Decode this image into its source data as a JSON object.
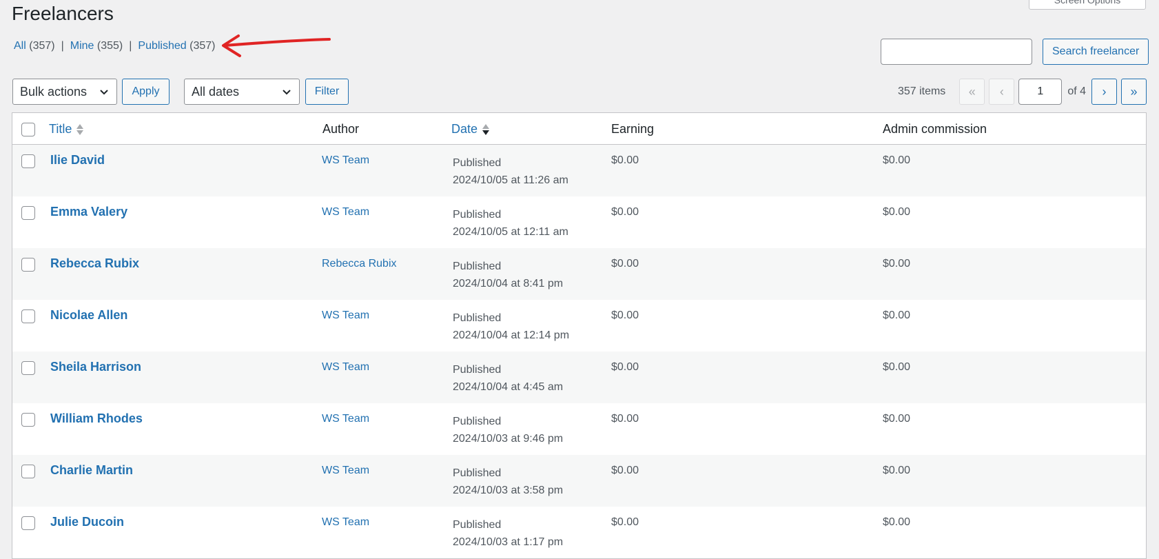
{
  "screen_options": {
    "label": "Screen Options"
  },
  "page": {
    "title": "Freelancers"
  },
  "views": [
    {
      "label": "All",
      "count": "(357)"
    },
    {
      "label": "Mine",
      "count": "(355)"
    },
    {
      "label": "Published",
      "count": "(357)"
    }
  ],
  "separator": "|",
  "search": {
    "value": "",
    "button_label": "Search freelancer"
  },
  "toolbar": {
    "bulk_actions": "Bulk actions",
    "apply_label": "Apply",
    "dates": "All dates",
    "filter_label": "Filter"
  },
  "pagination": {
    "items": "357 items",
    "first": "«",
    "prev": "‹",
    "current": "1",
    "of_label": "of 4",
    "next": "›",
    "last": "»"
  },
  "columns": {
    "title": "Title",
    "author": "Author",
    "date": "Date",
    "earning": "Earning",
    "commission": "Admin commission"
  },
  "rows": [
    {
      "title": "Ilie David",
      "author": "WS Team",
      "status": "Published",
      "date": "2024/10/05 at 11:26 am",
      "earning": "$0.00",
      "commission": "$0.00"
    },
    {
      "title": "Emma Valery",
      "author": "WS Team",
      "status": "Published",
      "date": "2024/10/05 at 12:11 am",
      "earning": "$0.00",
      "commission": "$0.00"
    },
    {
      "title": "Rebecca Rubix",
      "author": "Rebecca Rubix",
      "status": "Published",
      "date": "2024/10/04 at 8:41 pm",
      "earning": "$0.00",
      "commission": "$0.00"
    },
    {
      "title": "Nicolae Allen",
      "author": "WS Team",
      "status": "Published",
      "date": "2024/10/04 at 12:14 pm",
      "earning": "$0.00",
      "commission": "$0.00"
    },
    {
      "title": "Sheila Harrison",
      "author": "WS Team",
      "status": "Published",
      "date": "2024/10/04 at 4:45 am",
      "earning": "$0.00",
      "commission": "$0.00"
    },
    {
      "title": "William Rhodes",
      "author": "WS Team",
      "status": "Published",
      "date": "2024/10/03 at 9:46 pm",
      "earning": "$0.00",
      "commission": "$0.00"
    },
    {
      "title": "Charlie Martin",
      "author": "WS Team",
      "status": "Published",
      "date": "2024/10/03 at 3:58 pm",
      "earning": "$0.00",
      "commission": "$0.00"
    },
    {
      "title": "Julie Ducoin",
      "author": "WS Team",
      "status": "Published",
      "date": "2024/10/03 at 1:17 pm",
      "earning": "$0.00",
      "commission": "$0.00"
    }
  ],
  "colors": {
    "link": "#2271b1",
    "annotation": "#e02424",
    "background": "#f0f0f1"
  },
  "icons": {
    "sort_both": "sort-arrows-icon",
    "sort_desc": "sort-desc-icon",
    "dropdown": "chevron-down-icon",
    "annotation": "red-arrow-annotation"
  }
}
